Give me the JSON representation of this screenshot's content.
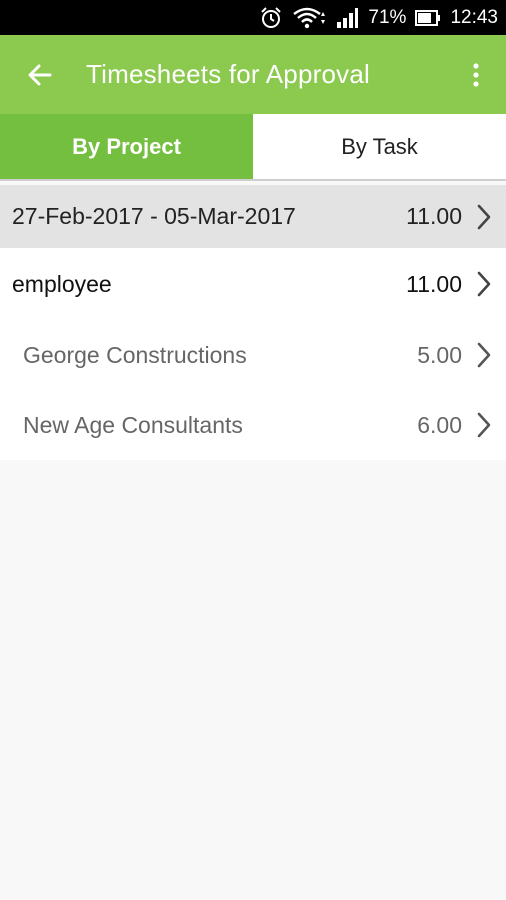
{
  "status_bar": {
    "icons": [
      "alarm-icon",
      "wifi-icon",
      "signal-icon",
      "battery-icon"
    ],
    "battery": "71%",
    "time": "12:43"
  },
  "app_bar": {
    "title": "Timesheets for Approval",
    "back_icon": "arrow-left-icon",
    "menu_icon": "more-vert-icon"
  },
  "tabs": [
    {
      "label": "By Project",
      "active": true
    },
    {
      "label": "By Task",
      "active": false
    }
  ],
  "period": {
    "label": "27-Feb-2017 - 05-Mar-2017",
    "value": "11.00"
  },
  "employee": {
    "label": "employee",
    "value": "11.00"
  },
  "projects": [
    {
      "label": "George Constructions",
      "value": "5.00"
    },
    {
      "label": "New Age Consultants",
      "value": "6.00"
    }
  ],
  "colors": {
    "app_bar": "#8bc94f",
    "active_tab": "#74bf3f",
    "period_row": "#e3e3e3",
    "background": "#f8f8f8"
  }
}
